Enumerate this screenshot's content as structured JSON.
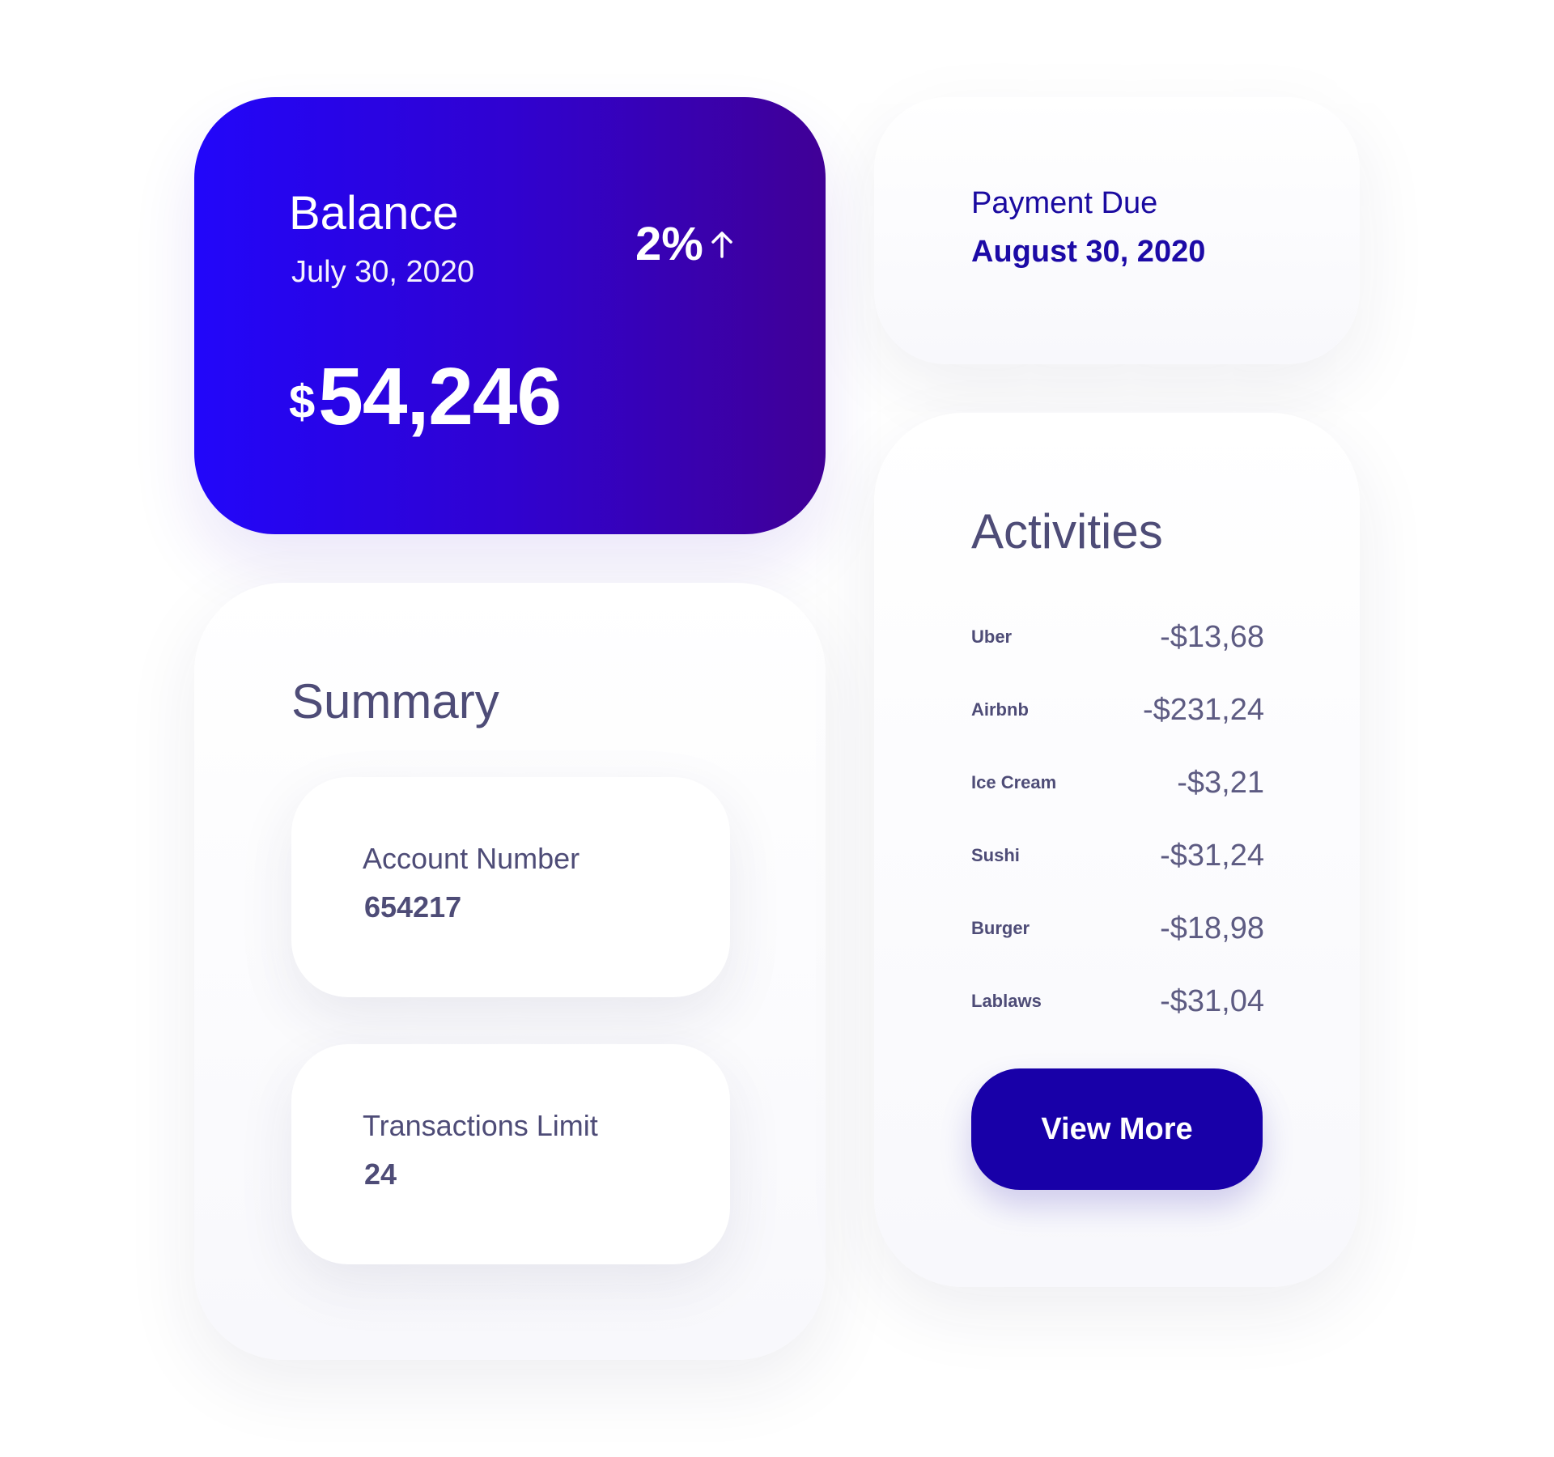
{
  "balance": {
    "title": "Balance",
    "date": "July 30, 2020",
    "change": "2%",
    "change_direction_icon": "arrow-up-icon",
    "currency": "$",
    "amount": "54,246",
    "colors": {
      "gradient_start": "#2206fa",
      "gradient_end": "#400096"
    }
  },
  "payment_due": {
    "label": "Payment Due",
    "date": "August 30, 2020"
  },
  "summary": {
    "title": "Summary",
    "account": {
      "label": "Account Number",
      "value": "654217"
    },
    "limit": {
      "label": "Transactions Limit",
      "value": "24"
    }
  },
  "activities": {
    "title": "Activities",
    "items": [
      {
        "name": "Uber",
        "amount": "-$13,68"
      },
      {
        "name": "Airbnb",
        "amount": "-$231,24"
      },
      {
        "name": "Ice Cream",
        "amount": "-$3,21"
      },
      {
        "name": "Sushi",
        "amount": "-$31,24"
      },
      {
        "name": "Burger",
        "amount": "-$18,98"
      },
      {
        "name": "Lablaws",
        "amount": "-$31,04"
      }
    ],
    "button_label": "View More",
    "button_color": "#1800a8"
  }
}
